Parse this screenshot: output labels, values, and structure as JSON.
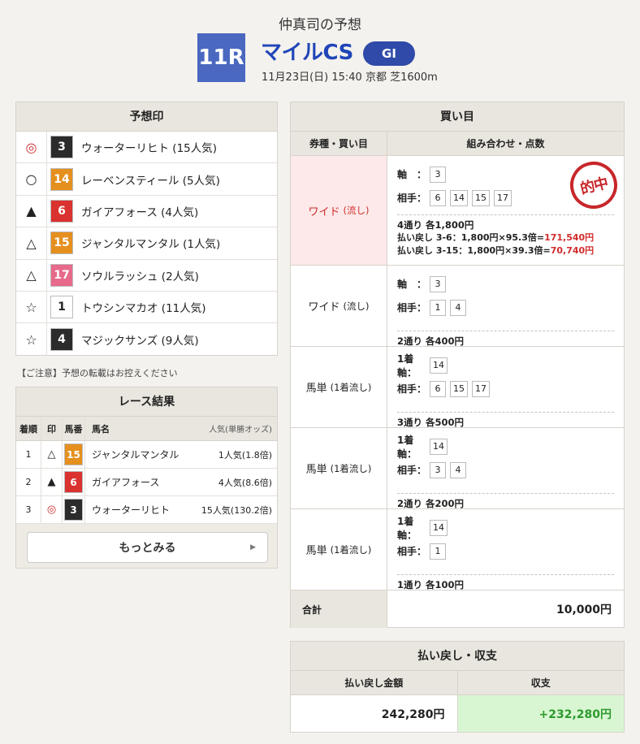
{
  "header": {
    "author": "仲真司の予想",
    "race_number": "11R",
    "race_name": "マイルCS",
    "grade": "GI",
    "race_info": "11月23日(日) 15:40 京都 芝1600m"
  },
  "predictions": {
    "title": "予想印",
    "items": [
      {
        "mark": "◎",
        "num": "3",
        "color": "#2b2b2b",
        "name": "ウォーターリヒト",
        "pop": "(15人気)",
        "red": true
      },
      {
        "mark": "○",
        "num": "14",
        "color": "#e58f1e",
        "name": "レーベンスティール",
        "pop": "(5人気)",
        "red": false
      },
      {
        "mark": "▲",
        "num": "6",
        "color": "#d9322f",
        "name": "ガイアフォース",
        "pop": "(4人気)",
        "red": false
      },
      {
        "mark": "△",
        "num": "15",
        "color": "#e58f1e",
        "name": "ジャンタルマンタル",
        "pop": "(1人気)",
        "red": false
      },
      {
        "mark": "△",
        "num": "17",
        "color": "#e76a8a",
        "name": "ソウルラッシュ",
        "pop": "(2人気)",
        "red": false
      },
      {
        "mark": "☆",
        "num": "1",
        "color": "#ffffff",
        "name": "トウシンマカオ",
        "pop": "(11人気)",
        "red": false
      },
      {
        "mark": "☆",
        "num": "4",
        "color": "#2b2b2b",
        "name": "マジックサンズ",
        "pop": "(9人気)",
        "red": false
      }
    ]
  },
  "note": "【ご注意】予想の転載はお控えください",
  "results": {
    "title": "レース結果",
    "headers": {
      "rank": "着順",
      "mark": "印",
      "num": "馬番",
      "name": "馬名",
      "pop": "人気(単勝オッズ)"
    },
    "rows": [
      {
        "rank": "1",
        "mark": "△",
        "num": "15",
        "color": "#e58f1e",
        "name": "ジャンタルマンタル",
        "pop": "1人気(1.8倍)",
        "red": false
      },
      {
        "rank": "2",
        "mark": "▲",
        "num": "6",
        "color": "#d9322f",
        "name": "ガイアフォース",
        "pop": "4人気(8.6倍)",
        "red": false
      },
      {
        "rank": "3",
        "mark": "◎",
        "num": "3",
        "color": "#2b2b2b",
        "name": "ウォーターリヒト",
        "pop": "15人気(130.2倍)",
        "red": true
      }
    ],
    "more_label": "もっとみる"
  },
  "bets": {
    "title": "買い目",
    "headers": {
      "type": "券種・買い目",
      "combo": "組み合わせ・点数"
    },
    "stamp": "的中",
    "rows": [
      {
        "type": "ワイド",
        "sub": "(流し)",
        "hit": true,
        "lines": [
          {
            "label": "軸　：",
            "nums": [
              "3"
            ]
          },
          {
            "label": "相手：",
            "nums": [
              "6",
              "14",
              "15",
              "17"
            ]
          }
        ],
        "summary": "4通り 各1,800円",
        "payouts": [
          {
            "text": "払い戻し 3-6：1,800円×95.3倍=",
            "amount": "171,540円"
          },
          {
            "text": "払い戻し 3-15：1,800円×39.3倍=",
            "amount": "70,740円"
          }
        ]
      },
      {
        "type": "ワイド",
        "sub": "(流し)",
        "hit": false,
        "lines": [
          {
            "label": "軸　：",
            "nums": [
              "3"
            ]
          },
          {
            "label": "相手：",
            "nums": [
              "1",
              "4"
            ]
          }
        ],
        "summary": "2通り 各400円",
        "payouts": []
      },
      {
        "type": "馬単",
        "sub": "(1着流し)",
        "hit": false,
        "lines": [
          {
            "label": "1着軸：",
            "nums": [
              "14"
            ]
          },
          {
            "label": "相手：",
            "nums": [
              "6",
              "15",
              "17"
            ]
          }
        ],
        "summary": "3通り 各500円",
        "payouts": []
      },
      {
        "type": "馬単",
        "sub": "(1着流し)",
        "hit": false,
        "lines": [
          {
            "label": "1着軸：",
            "nums": [
              "14"
            ]
          },
          {
            "label": "相手：",
            "nums": [
              "3",
              "4"
            ]
          }
        ],
        "summary": "2通り 各200円",
        "payouts": []
      },
      {
        "type": "馬単",
        "sub": "(1着流し)",
        "hit": false,
        "lines": [
          {
            "label": "1着軸：",
            "nums": [
              "14"
            ]
          },
          {
            "label": "相手：",
            "nums": [
              "1"
            ]
          }
        ],
        "summary": "1通り 各100円",
        "payouts": []
      }
    ],
    "total_label": "合計",
    "total_value": "10,000円"
  },
  "payout": {
    "title": "払い戻し・収支",
    "headers": {
      "refund": "払い戻し金額",
      "balance": "収支"
    },
    "refund": "242,280円",
    "balance": "+232,280円"
  }
}
